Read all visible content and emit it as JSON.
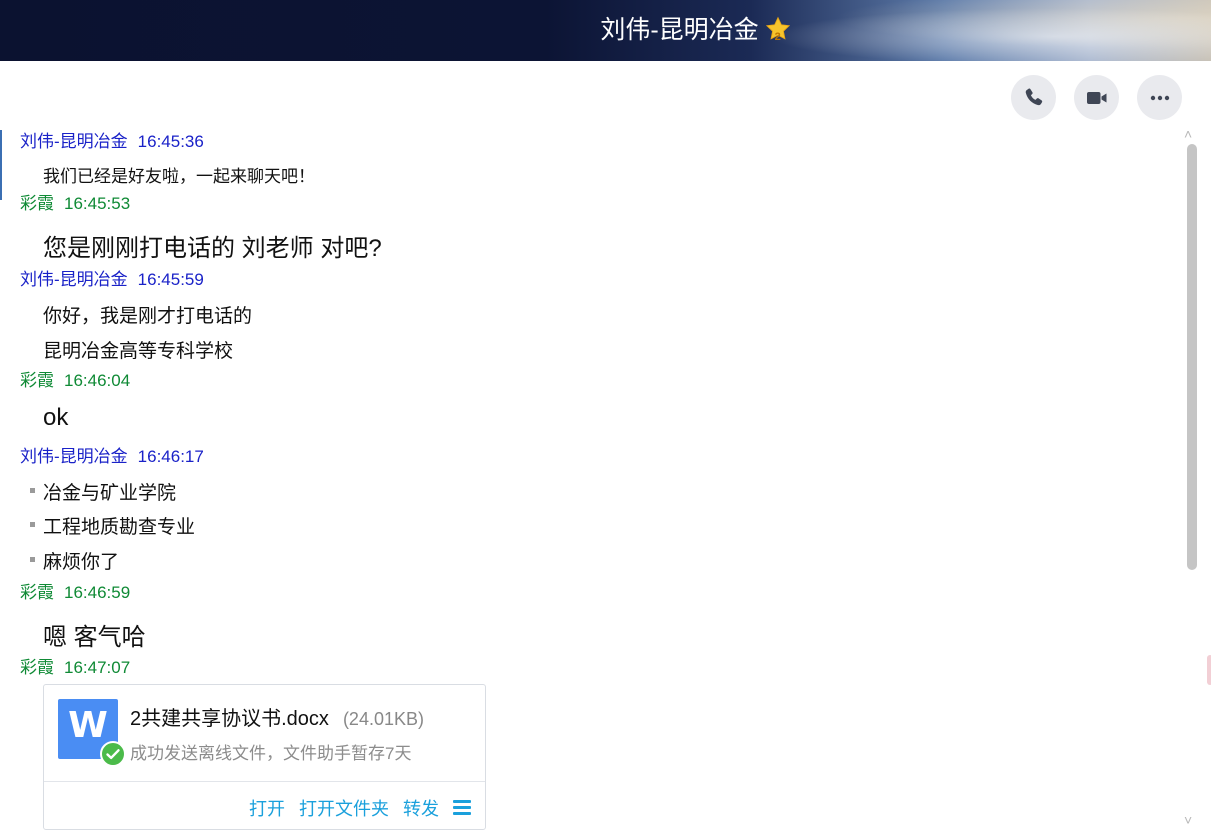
{
  "window": {
    "title": "刘伟-昆明冶金",
    "level_badge": "2"
  },
  "toolbar": {
    "call_icon": "phone-icon",
    "video_icon": "video-camera-icon",
    "more_icon": "more-dots-icon"
  },
  "colors": {
    "other_sender": "#1a22c8",
    "self_sender": "#0f8a35",
    "link_action": "#1aa0dc"
  },
  "messages": [
    {
      "sender": "刘伟-昆明冶金",
      "time": "16:45:36",
      "lines": [
        "我们已经是好友啦，一起来聊天吧！"
      ]
    },
    {
      "sender": "彩霞",
      "time": "16:45:53",
      "lines": [
        "您是刚刚打电话的 刘老师 对吧?"
      ]
    },
    {
      "sender": "刘伟-昆明冶金",
      "time": "16:45:59",
      "lines": [
        "你好，我是刚才打电话的",
        "昆明冶金高等专科学校"
      ]
    },
    {
      "sender": "彩霞",
      "time": "16:46:04",
      "lines": [
        "ok"
      ]
    },
    {
      "sender": "刘伟-昆明冶金",
      "time": "16:46:17",
      "lines": [
        "冶金与矿业学院",
        "工程地质勘查专业",
        "麻烦你了"
      ]
    },
    {
      "sender": "彩霞",
      "time": "16:46:59",
      "lines": [
        "嗯 客气哈"
      ]
    },
    {
      "sender": "彩霞",
      "time": "16:47:07",
      "lines": []
    }
  ],
  "file": {
    "icon_letter": "W",
    "name": "2共建共享协议书.docx",
    "size": "(24.01KB)",
    "status": "成功发送离线文件，文件助手暂存7天",
    "actions": {
      "open": "打开",
      "open_folder": "打开文件夹",
      "forward": "转发"
    }
  },
  "scrollbar": {
    "up": "˄",
    "down": "˅"
  }
}
